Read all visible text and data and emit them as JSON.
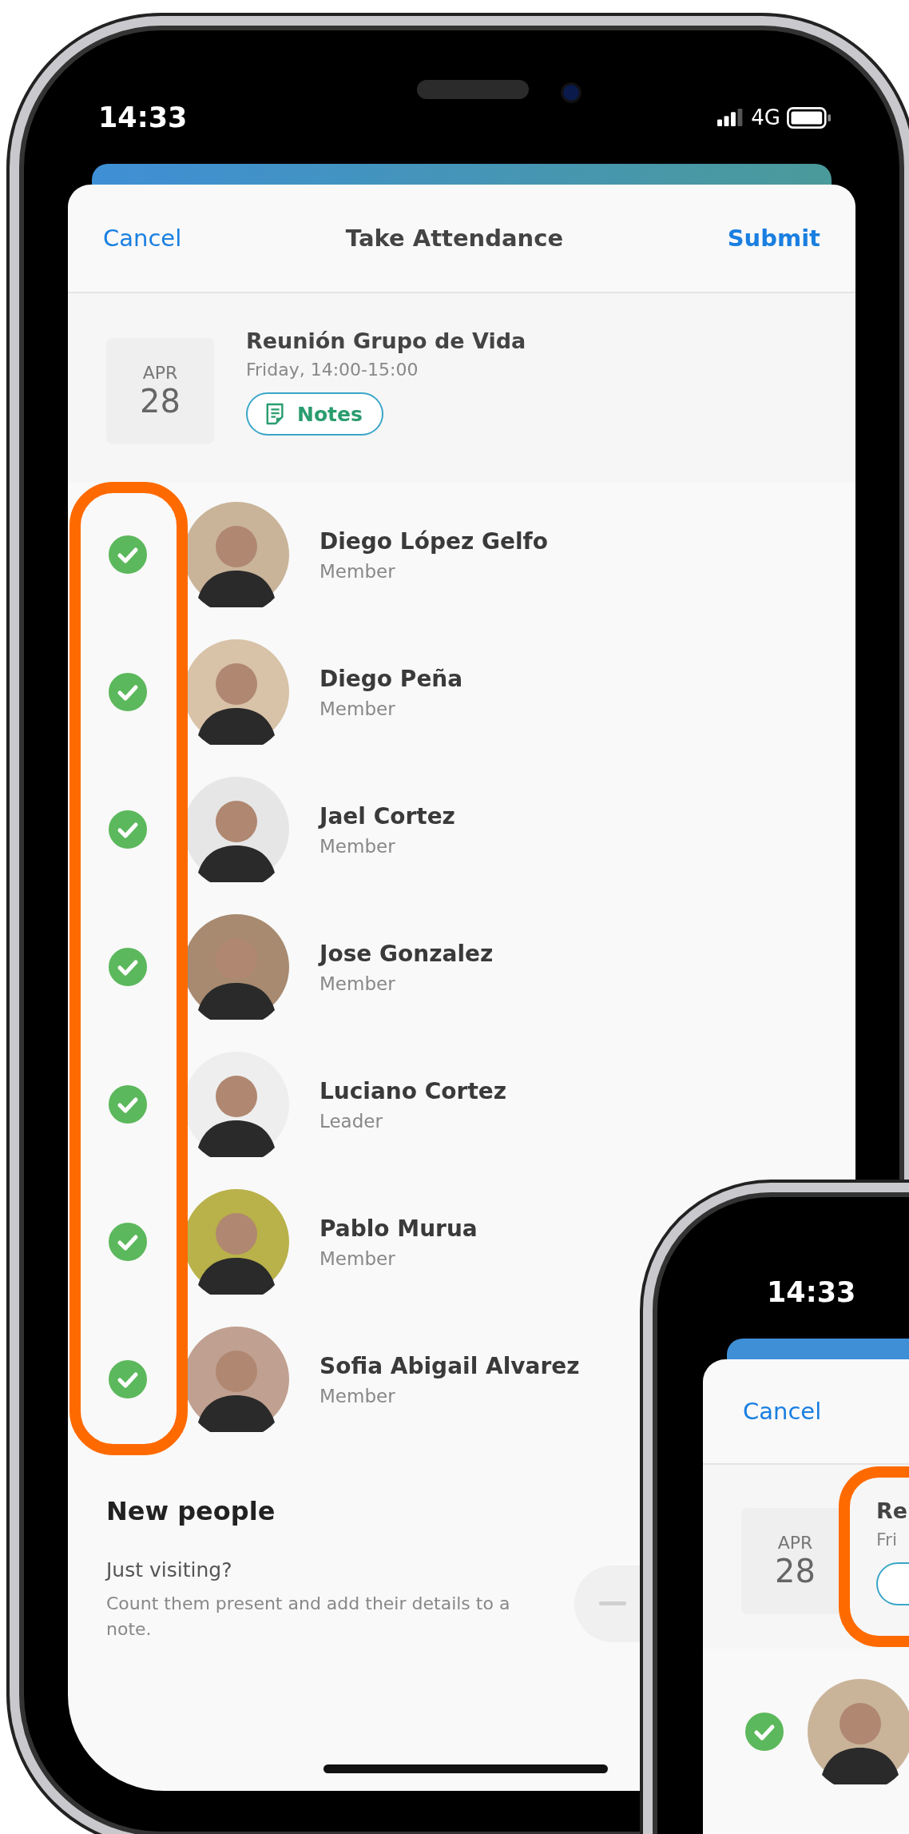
{
  "main_phone": {
    "status_bar": {
      "time": "14:33",
      "network": "4G"
    },
    "header": {
      "cancel": "Cancel",
      "title": "Take Attendance",
      "submit": "Submit"
    },
    "event": {
      "month": "APR",
      "day": "28",
      "title": "Reunión Grupo de Vida",
      "time": "Friday, 14:00-15:00",
      "notes_button": "Notes"
    },
    "people": [
      {
        "name": "Diego López Gelfo",
        "role": "Member",
        "checked": true
      },
      {
        "name": "Diego Peña",
        "role": "Member",
        "checked": true
      },
      {
        "name": "Jael Cortez",
        "role": "Member",
        "checked": true
      },
      {
        "name": "Jose Gonzalez",
        "role": "Member",
        "checked": true
      },
      {
        "name": "Luciano Cortez",
        "role": "Leader",
        "checked": true
      },
      {
        "name": "Pablo Murua",
        "role": "Member",
        "checked": true
      },
      {
        "name": "Sofia Abigail Alvarez",
        "role": "Member",
        "checked": true
      }
    ],
    "new_people": {
      "title": "New people",
      "question": "Just visiting?",
      "description": "Count them present and add their details to a note."
    }
  },
  "second_phone": {
    "status_bar": {
      "time": "14:33"
    },
    "header": {
      "cancel": "Cancel"
    },
    "event": {
      "month": "APR",
      "day": "28",
      "title": "Re",
      "time": "Fri"
    },
    "people": [
      {
        "checked": true
      }
    ]
  }
}
